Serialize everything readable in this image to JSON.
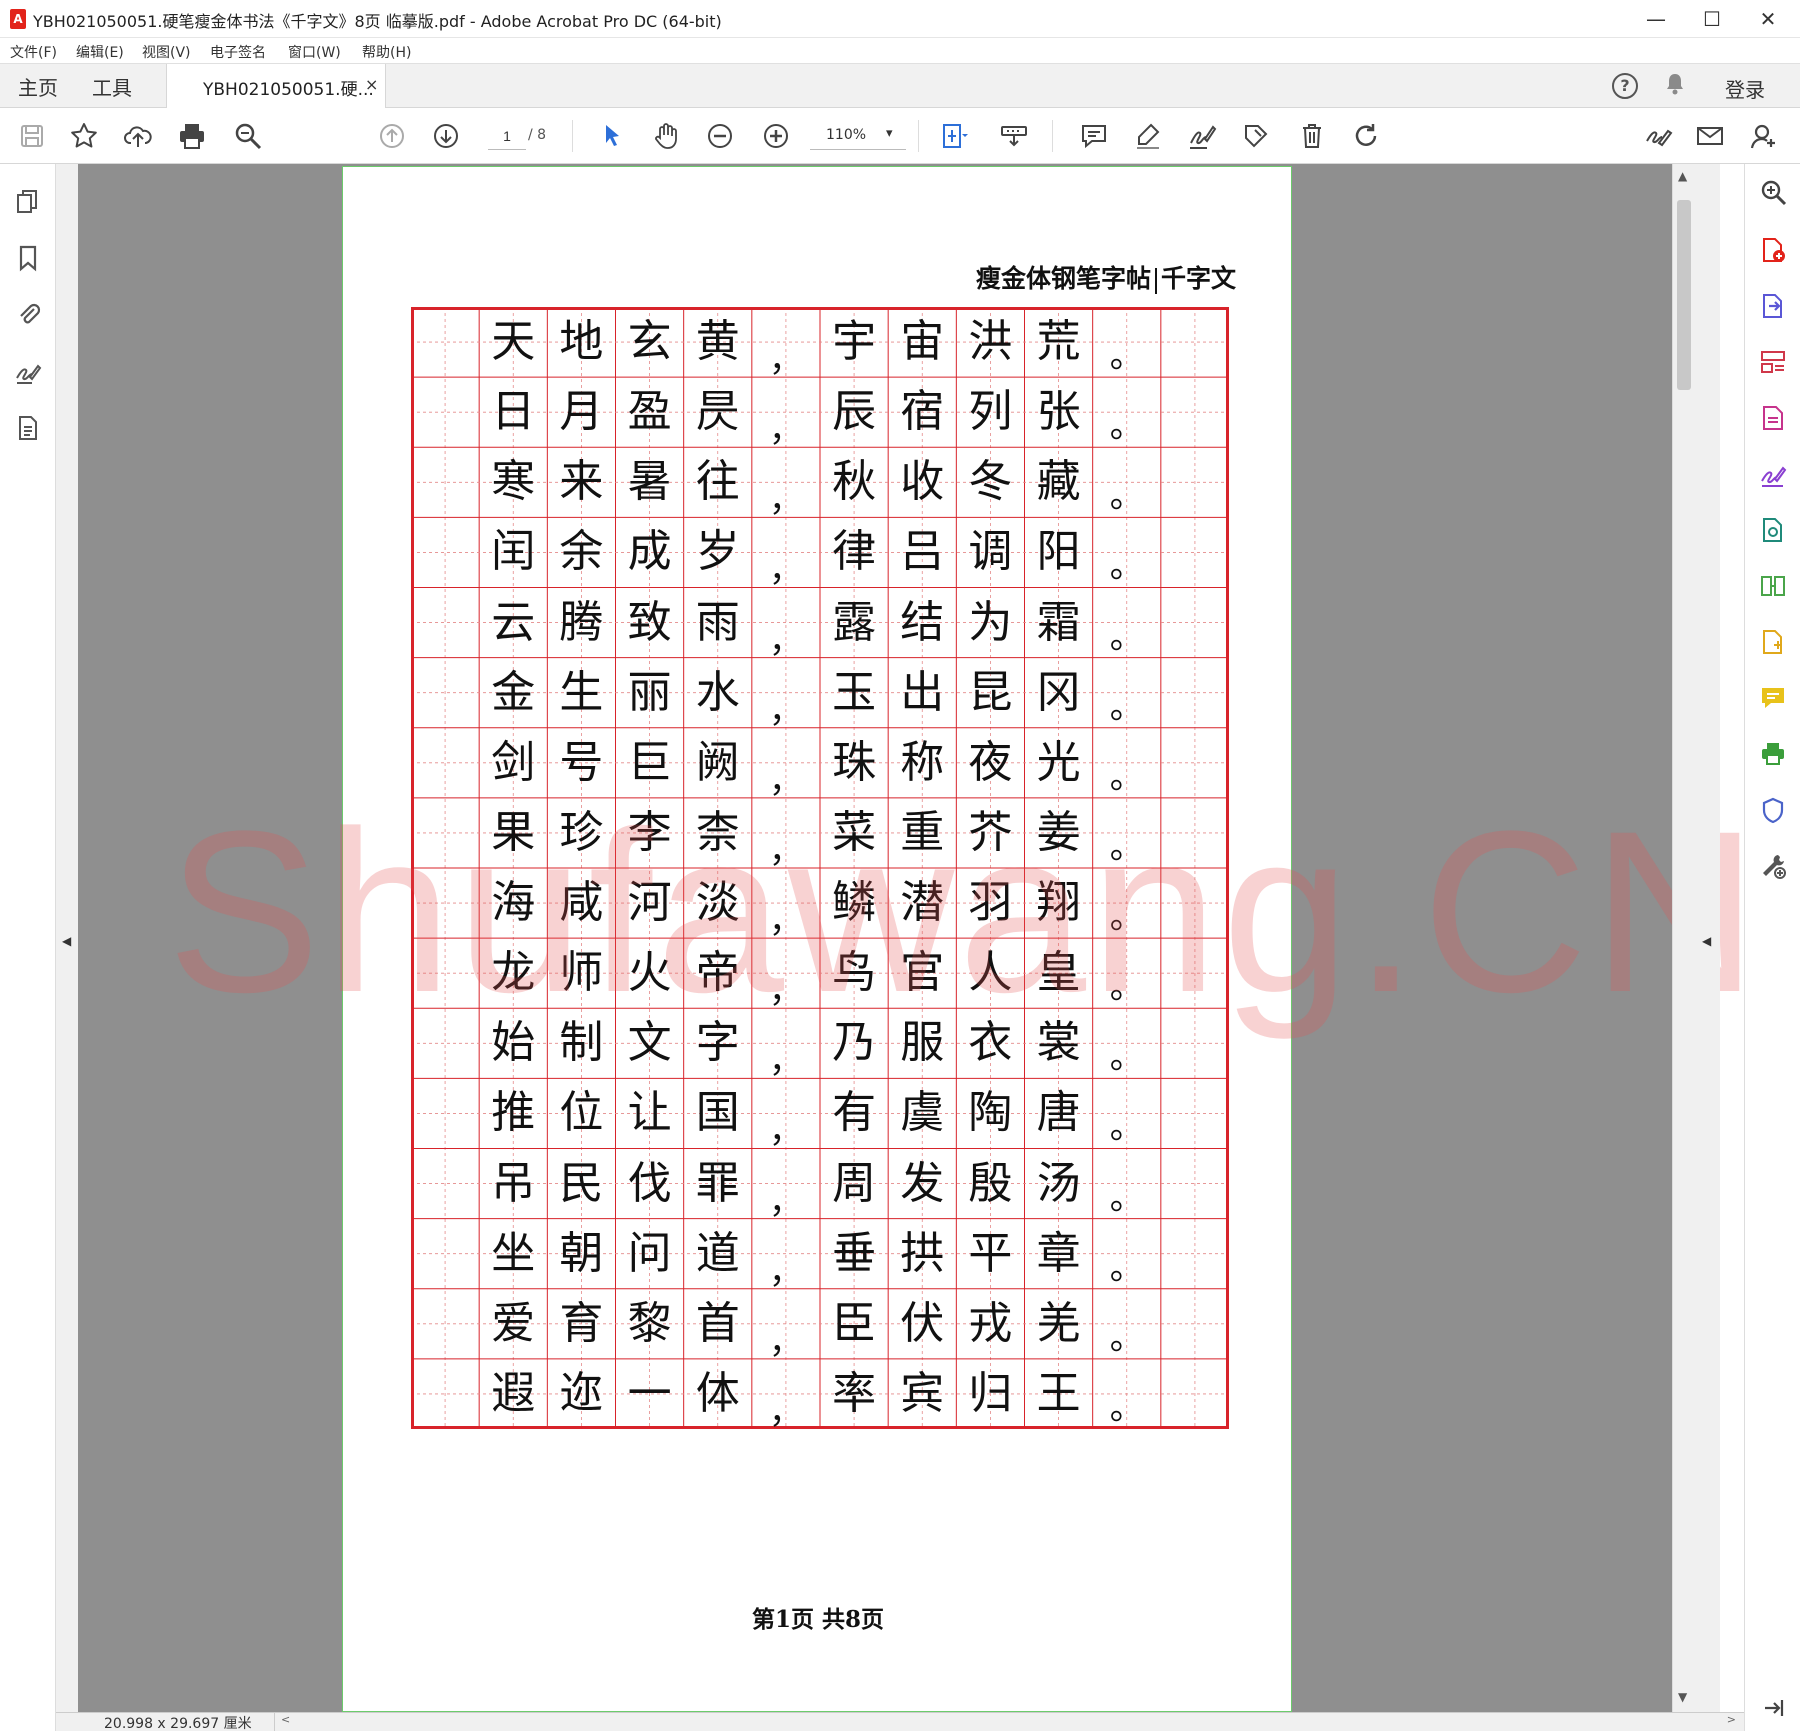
{
  "window": {
    "title": "YBH021050051.硬笔瘦金体书法《千字文》8页 临摹版.pdf - Adobe Acrobat Pro DC (64-bit)",
    "minimize": "—",
    "maximize": "☐",
    "close": "✕"
  },
  "menu": [
    "文件(F)",
    "编辑(E)",
    "视图(V)",
    "电子签名",
    "窗口(W)",
    "帮助(H)"
  ],
  "tabs": {
    "home": "主页",
    "tools": "工具",
    "document": "YBH021050051.硬...",
    "close": "×",
    "help": "?",
    "login": "登录"
  },
  "toolbar": {
    "page_current": "1",
    "page_total": "/ 8",
    "zoom": "110%"
  },
  "page": {
    "header_left": "瘦金体钢笔字帖",
    "header_right": "千字文",
    "footer": "第1页  共8页",
    "watermark": "Shufawang.CN"
  },
  "grid": {
    "rows": [
      [
        "天",
        "地",
        "玄",
        "黄",
        "宇",
        "宙",
        "洪",
        "荒"
      ],
      [
        "日",
        "月",
        "盈",
        "昃",
        "辰",
        "宿",
        "列",
        "张"
      ],
      [
        "寒",
        "来",
        "暑",
        "往",
        "秋",
        "收",
        "冬",
        "藏"
      ],
      [
        "闰",
        "余",
        "成",
        "岁",
        "律",
        "吕",
        "调",
        "阳"
      ],
      [
        "云",
        "腾",
        "致",
        "雨",
        "露",
        "结",
        "为",
        "霜"
      ],
      [
        "金",
        "生",
        "丽",
        "水",
        "玉",
        "出",
        "昆",
        "冈"
      ],
      [
        "剑",
        "号",
        "巨",
        "阙",
        "珠",
        "称",
        "夜",
        "光"
      ],
      [
        "果",
        "珍",
        "李",
        "柰",
        "菜",
        "重",
        "芥",
        "姜"
      ],
      [
        "海",
        "咸",
        "河",
        "淡",
        "鳞",
        "潜",
        "羽",
        "翔"
      ],
      [
        "龙",
        "师",
        "火",
        "帝",
        "鸟",
        "官",
        "人",
        "皇"
      ],
      [
        "始",
        "制",
        "文",
        "字",
        "乃",
        "服",
        "衣",
        "裳"
      ],
      [
        "推",
        "位",
        "让",
        "国",
        "有",
        "虞",
        "陶",
        "唐"
      ],
      [
        "吊",
        "民",
        "伐",
        "罪",
        "周",
        "发",
        "殷",
        "汤"
      ],
      [
        "坐",
        "朝",
        "问",
        "道",
        "垂",
        "拱",
        "平",
        "章"
      ],
      [
        "爱",
        "育",
        "黎",
        "首",
        "臣",
        "伏",
        "戎",
        "羌"
      ],
      [
        "遐",
        "迩",
        "一",
        "体",
        "率",
        "宾",
        "归",
        "王"
      ]
    ],
    "comma": "，",
    "period": "。",
    "line_color": "#d8232a",
    "guide_color": "#e48a8a"
  },
  "status": {
    "dimensions": "20.998 x 29.697 厘米"
  },
  "colors": {
    "acrobat_red": "#e2231a",
    "tool_blue": "#2d6fd8"
  }
}
